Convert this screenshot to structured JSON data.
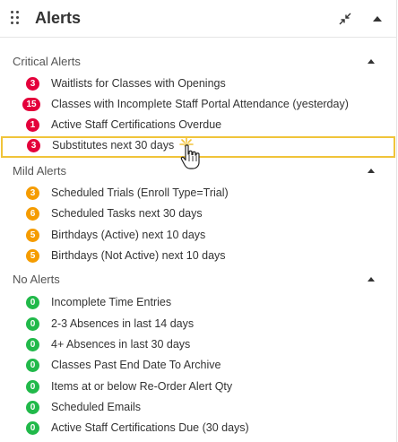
{
  "header": {
    "title": "Alerts"
  },
  "colors": {
    "critical": "#e4003b",
    "mild": "#f59c00",
    "none": "#21b94a",
    "highlight": "#f0c43a"
  },
  "sections": [
    {
      "title": "Critical Alerts",
      "items": [
        {
          "count": "3",
          "label": "Waitlists for Classes with Openings"
        },
        {
          "count": "15",
          "label": "Classes with Incomplete Staff Portal Attendance (yesterday)"
        },
        {
          "count": "1",
          "label": "Active Staff Certifications Overdue"
        },
        {
          "count": "3",
          "label": "Substitutes next 30 days"
        }
      ]
    },
    {
      "title": "Mild Alerts",
      "items": [
        {
          "count": "3",
          "label": "Scheduled Trials (Enroll Type=Trial)"
        },
        {
          "count": "6",
          "label": "Scheduled Tasks next 30 days"
        },
        {
          "count": "5",
          "label": "Birthdays (Active) next 10 days"
        },
        {
          "count": "5",
          "label": "Birthdays (Not Active) next 10 days"
        }
      ]
    },
    {
      "title": "No Alerts",
      "items": [
        {
          "count": "0",
          "label": "Incomplete Time Entries"
        },
        {
          "count": "0",
          "label": "2-3 Absences in last 14 days"
        },
        {
          "count": "0",
          "label": "4+ Absences in last 30 days"
        },
        {
          "count": "0",
          "label": "Classes Past End Date To Archive"
        },
        {
          "count": "0",
          "label": "Items at or below Re-Order Alert Qty"
        },
        {
          "count": "0",
          "label": "Scheduled Emails"
        },
        {
          "count": "0",
          "label": "Active Staff Certifications Due (30 days)"
        }
      ]
    }
  ]
}
